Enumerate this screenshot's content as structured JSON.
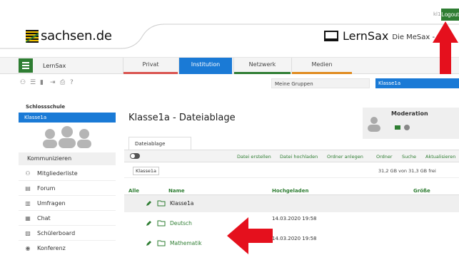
{
  "header": {
    "user": "kl1a",
    "logout_label": "Logout",
    "logo_text": "sachsen.de",
    "brand_name": "LernSax",
    "brand_sub": "Die MeSax - Sc"
  },
  "nav": {
    "app_label": "LernSax",
    "tabs": [
      {
        "label": "Privat",
        "color": "#d9534f"
      },
      {
        "label": "Institution",
        "color": "#1a7ad6"
      },
      {
        "label": "Netzwerk",
        "color": "#2e7d32"
      },
      {
        "label": "Medien",
        "color": "#e08a1e"
      }
    ]
  },
  "toolbar": {
    "groups_label": "Meine Gruppen",
    "groups_selected": "Klasse1a"
  },
  "sidebar": {
    "school": "Schlossschule",
    "class": "Klasse1a",
    "section": "Kommunizieren",
    "items": [
      {
        "label": "Mitgliederliste",
        "icon": "members-icon"
      },
      {
        "label": "Forum",
        "icon": "forum-icon"
      },
      {
        "label": "Umfragen",
        "icon": "poll-icon"
      },
      {
        "label": "Chat",
        "icon": "chat-icon"
      },
      {
        "label": "Schülerboard",
        "icon": "board-icon"
      },
      {
        "label": "Konferenz",
        "icon": "conference-icon"
      }
    ]
  },
  "main": {
    "title": "Klasse1a - Dateiablage",
    "moderation_title": "Moderation",
    "subtab": "Dateiablage",
    "actions": [
      "Datei erstellen",
      "Datei hochladen",
      "Ordner anlegen",
      "Ordner",
      "Suche",
      "Aktualisieren"
    ],
    "path": "Klasse1a",
    "quota": "31,2 GB von 31,3 GB frei",
    "columns": {
      "all": "Alle",
      "name": "Name",
      "uploaded": "Hochgeladen",
      "size": "Größe"
    },
    "rows": [
      {
        "name": "Klasse1a",
        "date": ""
      },
      {
        "name": "Deutsch",
        "date": "14.03.2020 19:58"
      },
      {
        "name": "Mathematik",
        "date": "14.03.2020 19:58"
      }
    ]
  },
  "colors": {
    "accent_green": "#2e7d32",
    "accent_blue": "#1a7ad6",
    "arrow_red": "#e5101d"
  }
}
